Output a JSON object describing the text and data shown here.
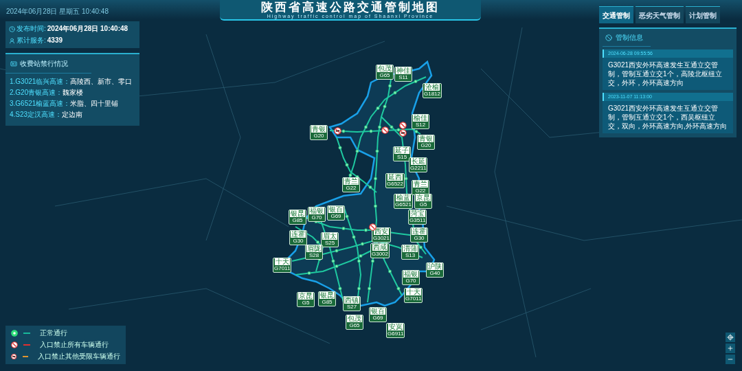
{
  "header": {
    "datetime": "2024年06月28日 星期五  10:40:48",
    "title": "陕西省高速公路交通管制地图",
    "subtitle": "Highway traffic control map of Shaanxi Province"
  },
  "info": [
    {
      "kind": "clock",
      "label": "发布时间:",
      "value": "2024年06月28日  10:40:48"
    },
    {
      "kind": "user",
      "label": "累计服务:",
      "value": "4339"
    }
  ],
  "closures": {
    "title": "收费站禁行情况",
    "items": [
      {
        "route": "1.G3021临兴高速：",
        "stations": "高陵西、新市、零口"
      },
      {
        "route": "2.G20青银高速：",
        "stations": "魏家楼"
      },
      {
        "route": "3.G6521榆蓝高速：",
        "stations": "米脂、四十里铺"
      },
      {
        "route": "4.S23定汉高速：",
        "stations": "定边南"
      }
    ]
  },
  "tabs": [
    {
      "label": "交通管制",
      "selected": true
    },
    {
      "label": "恶劣天气管制",
      "selected": false
    },
    {
      "label": "计划管制",
      "selected": false
    }
  ],
  "control_info": {
    "title": "管制信息",
    "entries": [
      {
        "time": "2024-06-28 09:55:56",
        "text": "G3021西安外环高速发生互通立交管制，管制互通立交1个，高陵北枢纽立交，外环，外环高速方向"
      },
      {
        "time": "2023-11-07 11:13:00",
        "text": "G3021西安外环高速发生互通立交管制，管制互通立交1个，西吴枢纽立交，双向，外环高速方向,外环高速方向"
      }
    ]
  },
  "map": {
    "shields": [
      {
        "name": "包茂",
        "code": "G65"
      },
      {
        "name": "神佳",
        "code": "S11"
      },
      {
        "name": "沧榆",
        "code": "G1812"
      },
      {
        "name": "榆佳",
        "code": "S12"
      },
      {
        "name": "青银",
        "code": "G20"
      },
      {
        "name": "青银",
        "code": "G20"
      },
      {
        "name": "延子",
        "code": "S15"
      },
      {
        "name": "长延",
        "code": "G2211"
      },
      {
        "name": "青兰",
        "code": "G22"
      },
      {
        "name": "延西",
        "code": "G6522"
      },
      {
        "name": "青兰",
        "code": "G22"
      },
      {
        "name": "榆蓝",
        "code": "G6521"
      },
      {
        "name": "京昆",
        "code": "G5"
      },
      {
        "name": "银昆",
        "code": "G85"
      },
      {
        "name": "福银",
        "code": "G70"
      },
      {
        "name": "银百",
        "code": "G69"
      },
      {
        "name": "菏宝",
        "code": "G3511"
      },
      {
        "name": "连霍",
        "code": "G30"
      },
      {
        "name": "眉太",
        "code": "S25"
      },
      {
        "name": "西安",
        "code": "G3021"
      },
      {
        "name": "连霍",
        "code": "G30"
      },
      {
        "name": "眉陇",
        "code": "S28"
      },
      {
        "name": "西咸",
        "code": "G3002"
      },
      {
        "name": "渭蒲",
        "code": "S13"
      },
      {
        "name": "十天",
        "code": "G7011"
      },
      {
        "name": "沪陕",
        "code": "G40"
      },
      {
        "name": "福银",
        "code": "G70"
      },
      {
        "name": "十天",
        "code": "G7011"
      },
      {
        "name": "京昆",
        "code": "G5"
      },
      {
        "name": "银昆",
        "code": "G85"
      },
      {
        "name": "西镇",
        "code": "S27"
      },
      {
        "name": "包茂",
        "code": "G65"
      },
      {
        "name": "银百",
        "code": "G69"
      },
      {
        "name": "安岚",
        "code": "G6911"
      }
    ],
    "restrictions": [
      {
        "kind": "other"
      },
      {
        "kind": "all"
      },
      {
        "kind": "all"
      },
      {
        "kind": "other"
      },
      {
        "kind": "all"
      }
    ]
  },
  "legend": [
    {
      "kind": "normal",
      "color": "#18b89a",
      "label": "正常通行"
    },
    {
      "kind": "all",
      "color": "#e03030",
      "label": "入口禁止所有车辆通行"
    },
    {
      "kind": "other",
      "color": "#e0962e",
      "label": "入口禁止其他受限车辆通行"
    }
  ]
}
